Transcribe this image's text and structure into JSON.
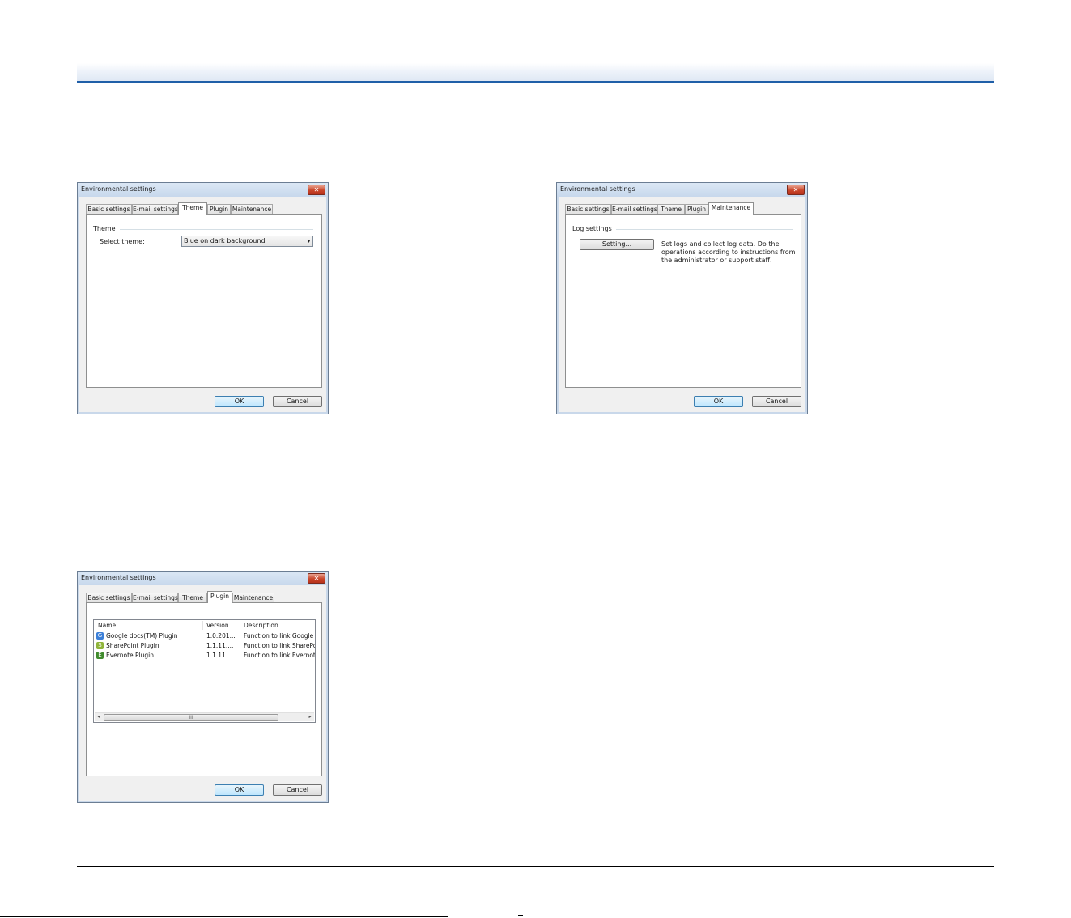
{
  "dialogs": [
    {
      "title": "Environmental settings",
      "close_glyph": "✕",
      "tabs": [
        "Basic settings",
        "E-mail settings",
        "Theme",
        "Plugin",
        "Maintenance"
      ],
      "active_tab": "Theme",
      "group_label": "Theme",
      "select_label": "Select theme:",
      "select_value": "Blue on dark background",
      "ok_label": "OK",
      "cancel_label": "Cancel"
    },
    {
      "title": "Environmental settings",
      "close_glyph": "✕",
      "tabs": [
        "Basic settings",
        "E-mail settings",
        "Theme",
        "Plugin",
        "Maintenance"
      ],
      "active_tab": "Maintenance",
      "group_label": "Log settings",
      "setting_button": "Setting...",
      "help_text": "Set logs and collect log data. Do the operations according to instructions from the administrator or support staff.",
      "ok_label": "OK",
      "cancel_label": "Cancel"
    },
    {
      "title": "Environmental settings",
      "close_glyph": "✕",
      "tabs": [
        "Basic settings",
        "E-mail settings",
        "Theme",
        "Plugin",
        "Maintenance"
      ],
      "active_tab": "Plugin",
      "columns": [
        "Name",
        "Version",
        "Description"
      ],
      "plugins": [
        {
          "name": "Google docs(TM) Plugin",
          "version": "1.0.201...",
          "description": "Function to link Google",
          "icon": "google-docs-icon",
          "color": "#3b7fd8"
        },
        {
          "name": "SharePoint Plugin",
          "version": "1.1.11....",
          "description": "Function to link SharePo",
          "icon": "sharepoint-icon",
          "color": "#8fb43a"
        },
        {
          "name": "Evernote Plugin",
          "version": "1.1.11....",
          "description": "Function to link Evernot",
          "icon": "evernote-icon",
          "color": "#3f8a2c"
        }
      ],
      "scroll_thumb_grip": "III",
      "scroll_left": "◂",
      "scroll_right": "▸",
      "ok_label": "OK",
      "cancel_label": "Cancel"
    }
  ],
  "combo_arrow": "▾",
  "colors": {
    "header_rule": "#1f5fa8",
    "close_button": "#c9452a",
    "default_button": "#bee6fd"
  }
}
